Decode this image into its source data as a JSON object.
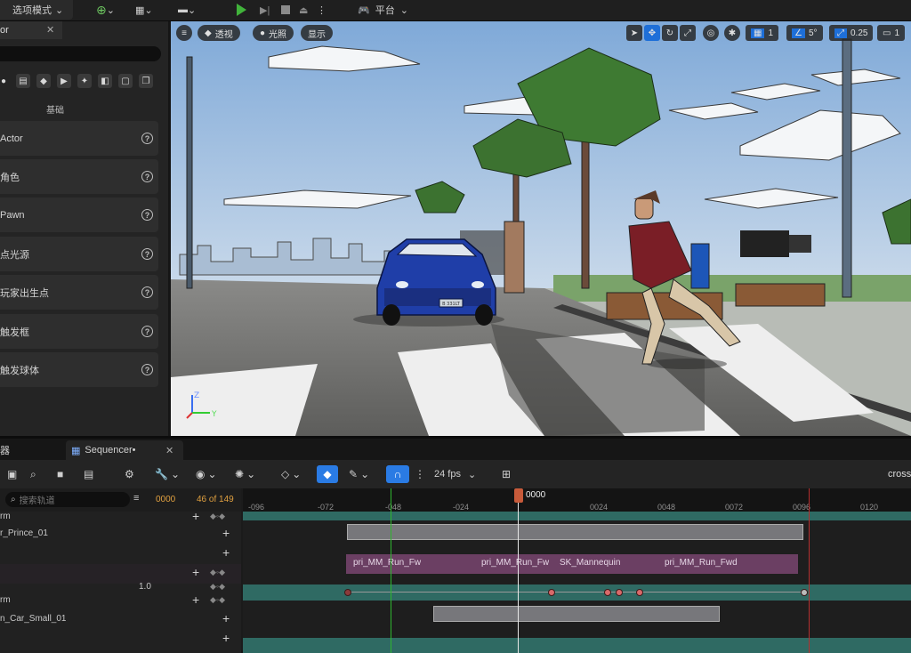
{
  "toolbar": {
    "mode_label": "选项模式",
    "platform_label": "平台"
  },
  "left_panel": {
    "tab_label": "or",
    "category_label": "基础",
    "items": [
      {
        "label": "Actor"
      },
      {
        "label": "角色"
      },
      {
        "label": "Pawn"
      },
      {
        "label": "点光源"
      },
      {
        "label": "玩家出生点"
      },
      {
        "label": "触发框"
      },
      {
        "label": "触发球体"
      }
    ]
  },
  "viewport": {
    "perspective_label": "透视",
    "lit_label": "光照",
    "show_label": "显示",
    "grid_snap": "1",
    "rotation_snap": "5°",
    "scale_snap": "0.25",
    "camera_speed": "1",
    "axis_labels": {
      "z": "Z",
      "y": "Y"
    },
    "license_plate": "B 331LT"
  },
  "sequencer": {
    "tabs": {
      "left_tab": "器",
      "main_tab": "Sequencer•"
    },
    "fps_label": "24 fps",
    "right_label": "cross",
    "search_placeholder": "搜索轨道",
    "current_frame": "0000",
    "frame_count": "46 of 149",
    "playhead_label": "0000",
    "ruler_ticks": [
      "-096",
      "-072",
      "-048",
      "-024",
      "0024",
      "0048",
      "0072",
      "0096",
      "0120"
    ],
    "tracks": [
      {
        "name": "rm"
      },
      {
        "name": "r_Prince_01"
      },
      {
        "name": ""
      },
      {
        "name": ""
      },
      {
        "name": "1.0"
      },
      {
        "name": "rm"
      },
      {
        "name": "n_Car_Small_01"
      },
      {
        "name": ""
      }
    ],
    "anim_clips": [
      "pri_MM_Run_Fw",
      "pri_MM_Run_Fw",
      "SK_Mannequin",
      "pri_MM_Run_Fwd"
    ]
  },
  "colors": {
    "accent_blue": "#2a7be4",
    "play_green": "#41b33b",
    "playhead": "#c75a3a",
    "transform_lane": "#2f6a63",
    "anim_lane": "#6b3f63"
  }
}
